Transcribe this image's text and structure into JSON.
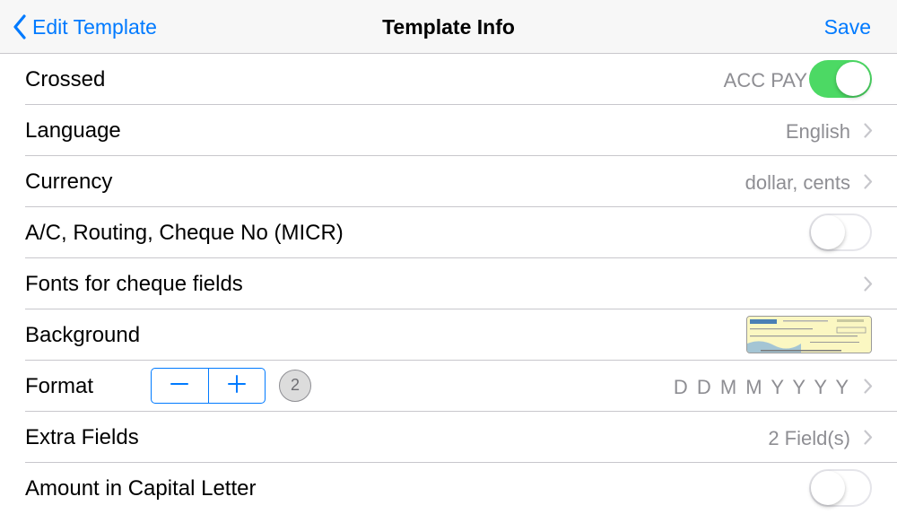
{
  "navbar": {
    "back_label": "Edit Template",
    "title": "Template Info",
    "save_label": "Save"
  },
  "rows": [
    {
      "label": "Crossed",
      "value": "ACC PAY",
      "toggle": "on"
    },
    {
      "label": "Language",
      "value": "English"
    },
    {
      "label": "Currency",
      "value": "dollar, cents"
    },
    {
      "label": "A/C, Routing, Cheque No (MICR)",
      "toggle": "off"
    },
    {
      "label": "Fonts for cheque fields"
    },
    {
      "label": "Background"
    },
    {
      "label": "Format",
      "value": "D D M M Y Y Y Y",
      "badge": "2"
    },
    {
      "label": "Extra Fields",
      "value": "2 Field(s)"
    },
    {
      "label": "Amount in Capital Letter",
      "toggle": "off"
    }
  ],
  "icons": {
    "back": "chevron-left-icon",
    "disclosure": "chevron-right-icon",
    "stepper_minus": "minus-icon",
    "stepper_plus": "plus-icon"
  },
  "colors": {
    "accent": "#007aff",
    "toggle_on": "#4cd964",
    "secondary_text": "#8e8e93"
  }
}
